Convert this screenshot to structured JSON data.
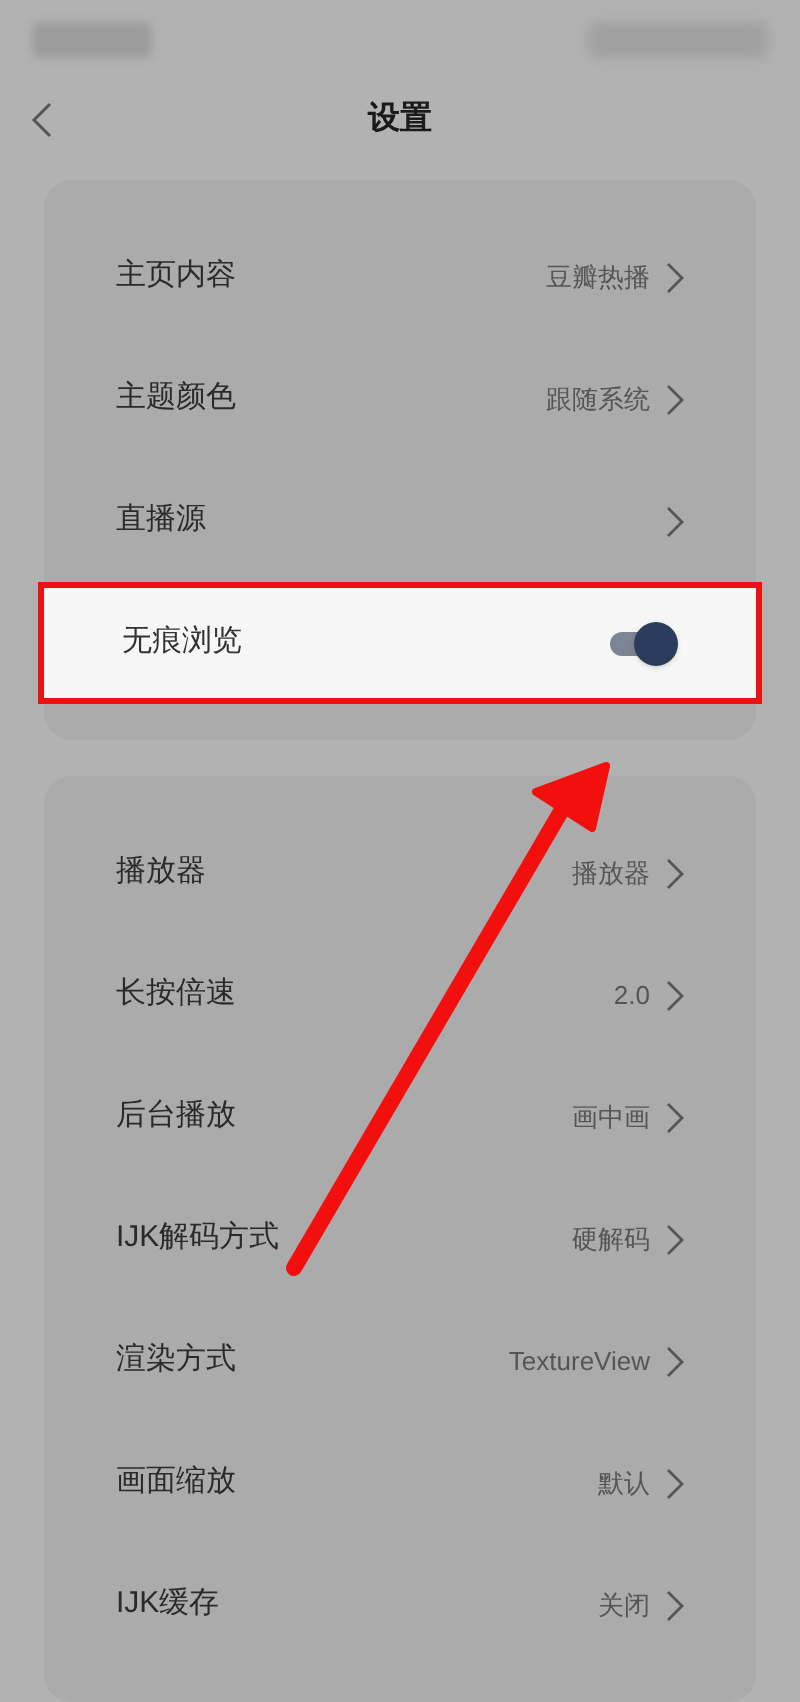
{
  "header": {
    "title": "设置"
  },
  "groups": [
    {
      "items": [
        {
          "kind": "link",
          "label": "主页内容",
          "value": "豆瓣热播",
          "highlighted": false
        },
        {
          "kind": "link",
          "label": "主题颜色",
          "value": "跟随系统",
          "highlighted": false
        },
        {
          "kind": "link",
          "label": "直播源",
          "highlighted": false
        },
        {
          "kind": "toggle",
          "label": "无痕浏览",
          "on": true,
          "highlighted": true
        }
      ]
    },
    {
      "items": [
        {
          "kind": "link",
          "label": "播放器",
          "value": "播放器",
          "highlighted": false
        },
        {
          "kind": "link",
          "label": "长按倍速",
          "value": "2.0",
          "highlighted": false
        },
        {
          "kind": "link",
          "label": "后台播放",
          "value": "画中画",
          "highlighted": false
        },
        {
          "kind": "link",
          "label": "IJK解码方式",
          "value": "硬解码",
          "highlighted": false
        },
        {
          "kind": "link",
          "label": "渲染方式",
          "value": "TextureView",
          "highlighted": false
        },
        {
          "kind": "link",
          "label": "画面缩放",
          "value": "默认",
          "highlighted": false
        },
        {
          "kind": "link",
          "label": "IJK缓存",
          "value": "关闭",
          "highlighted": false
        }
      ]
    }
  ]
}
